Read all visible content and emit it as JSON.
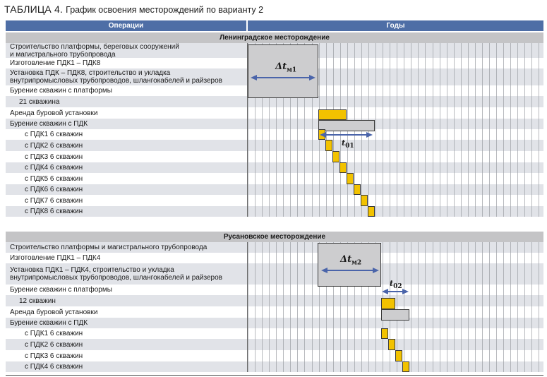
{
  "title": {
    "prefix": "ТАБЛИЦА 4.",
    "text": "График освоения месторождений по варианту 2"
  },
  "headers": {
    "operations": "Операции",
    "years": "Годы"
  },
  "sections": [
    {
      "name": "Ленинградское месторождение",
      "rows": [
        {
          "lines": [
            "Строительство платформы, береговых сооружений",
            "и магистрального трубопровода"
          ],
          "indent": 0
        },
        {
          "lines": [
            "Изготовление ПДК1 – ПДК8"
          ],
          "indent": 0
        },
        {
          "lines": [
            "Установка ПДК – ПДК8, строительство и укладка",
            "внутрипромысловых трубопроводов, шлангокабелей и райзеров"
          ],
          "indent": 0
        },
        {
          "lines": [
            "Бурение скважин с платформы"
          ],
          "indent": 0
        },
        {
          "lines": [
            "21 скважина"
          ],
          "indent": 1
        },
        {
          "lines": [
            "Аренда буровой установки"
          ],
          "indent": 0
        },
        {
          "lines": [
            "Бурение скважин с ПДК"
          ],
          "indent": 0
        },
        {
          "lines": [
            "с ПДК1 6 скважин"
          ],
          "indent": 2
        },
        {
          "lines": [
            "с ПДК2 6 скважин"
          ],
          "indent": 2
        },
        {
          "lines": [
            "с ПДК3 6 скважин"
          ],
          "indent": 2
        },
        {
          "lines": [
            "с ПДК4 6 скважин"
          ],
          "indent": 2
        },
        {
          "lines": [
            "с ПДК5 6 скважин"
          ],
          "indent": 2
        },
        {
          "lines": [
            "с ПДК6 6 скважин"
          ],
          "indent": 2
        },
        {
          "lines": [
            "с ПДК7 6 скважин"
          ],
          "indent": 2
        },
        {
          "lines": [
            "с ПДК8 6 скважин"
          ],
          "indent": 2
        }
      ]
    },
    {
      "name": "Русановское месторождение",
      "rows": [
        {
          "lines": [
            "Строительство платформы и магистрального трубопровода"
          ],
          "indent": 0
        },
        {
          "lines": [
            "Изготовление ПДК1 – ПДК4"
          ],
          "indent": 0
        },
        {
          "lines": [
            "Установка ПДК1 – ПДК4, строительство и укладка",
            "внутрипромысловых трубопроводов, шлангокабелей и райзеров"
          ],
          "indent": 0
        },
        {
          "lines": [
            "Бурение скважин с платформы"
          ],
          "indent": 0
        },
        {
          "lines": [
            "12 скважин"
          ],
          "indent": 1
        },
        {
          "lines": [
            "Аренда буровой установки"
          ],
          "indent": 0
        },
        {
          "lines": [
            "Бурение скважин с ПДК"
          ],
          "indent": 0
        },
        {
          "lines": [
            "с ПДК1 6 скважин"
          ],
          "indent": 2
        },
        {
          "lines": [
            "с ПДК2 6 скважин"
          ],
          "indent": 2
        },
        {
          "lines": [
            "с ПДК3 6 скважин"
          ],
          "indent": 2
        },
        {
          "lines": [
            "с ПДК4 6 скважин"
          ],
          "indent": 2
        }
      ]
    }
  ],
  "markers": [
    {
      "symbol": "Δt",
      "sub": "м1"
    },
    {
      "symbol": "t",
      "sub": "01"
    },
    {
      "symbol": "Δt",
      "sub": "м2"
    },
    {
      "symbol": "t",
      "sub": "02"
    }
  ],
  "colors": {
    "header": "#4e6ea6",
    "section": "#c4c4c6",
    "row_alt": "#e1e3e8",
    "bar_yellow": "#f2c200",
    "bar_gray": "#cdcdcf",
    "arrow": "#4a64aa"
  }
}
